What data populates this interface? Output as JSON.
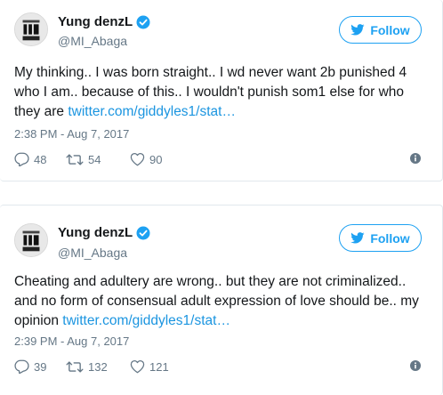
{
  "tweets": [
    {
      "author": {
        "display_name": "Yung denzL",
        "handle": "@MI_Abaga",
        "avatar_icon": "avatar-icon"
      },
      "follow_label": "Follow",
      "text": "My thinking.. I was born straight.. I wd never want 2b punished 4 who I am.. because of this.. I wouldn't punish som1 else for who they are ",
      "link": "twitter.com/giddyles1/stat…",
      "timestamp": "2:38 PM - Aug 7, 2017",
      "replies": "48",
      "retweets": "54",
      "likes": "90"
    },
    {
      "author": {
        "display_name": "Yung denzL",
        "handle": "@MI_Abaga",
        "avatar_icon": "avatar-icon"
      },
      "follow_label": "Follow",
      "text": "Cheating and adultery are wrong.. but they are not criminalized.. and no form of consensual adult expression of love should be.. my opinion ",
      "link": "twitter.com/giddyles1/stat…",
      "timestamp": "2:39 PM - Aug 7, 2017",
      "replies": "39",
      "retweets": "132",
      "likes": "121"
    }
  ],
  "colors": {
    "accent": "#1da1f2",
    "link": "#1b95e0",
    "muted": "#657786",
    "text": "#14171a",
    "border": "#e1e8ed"
  }
}
